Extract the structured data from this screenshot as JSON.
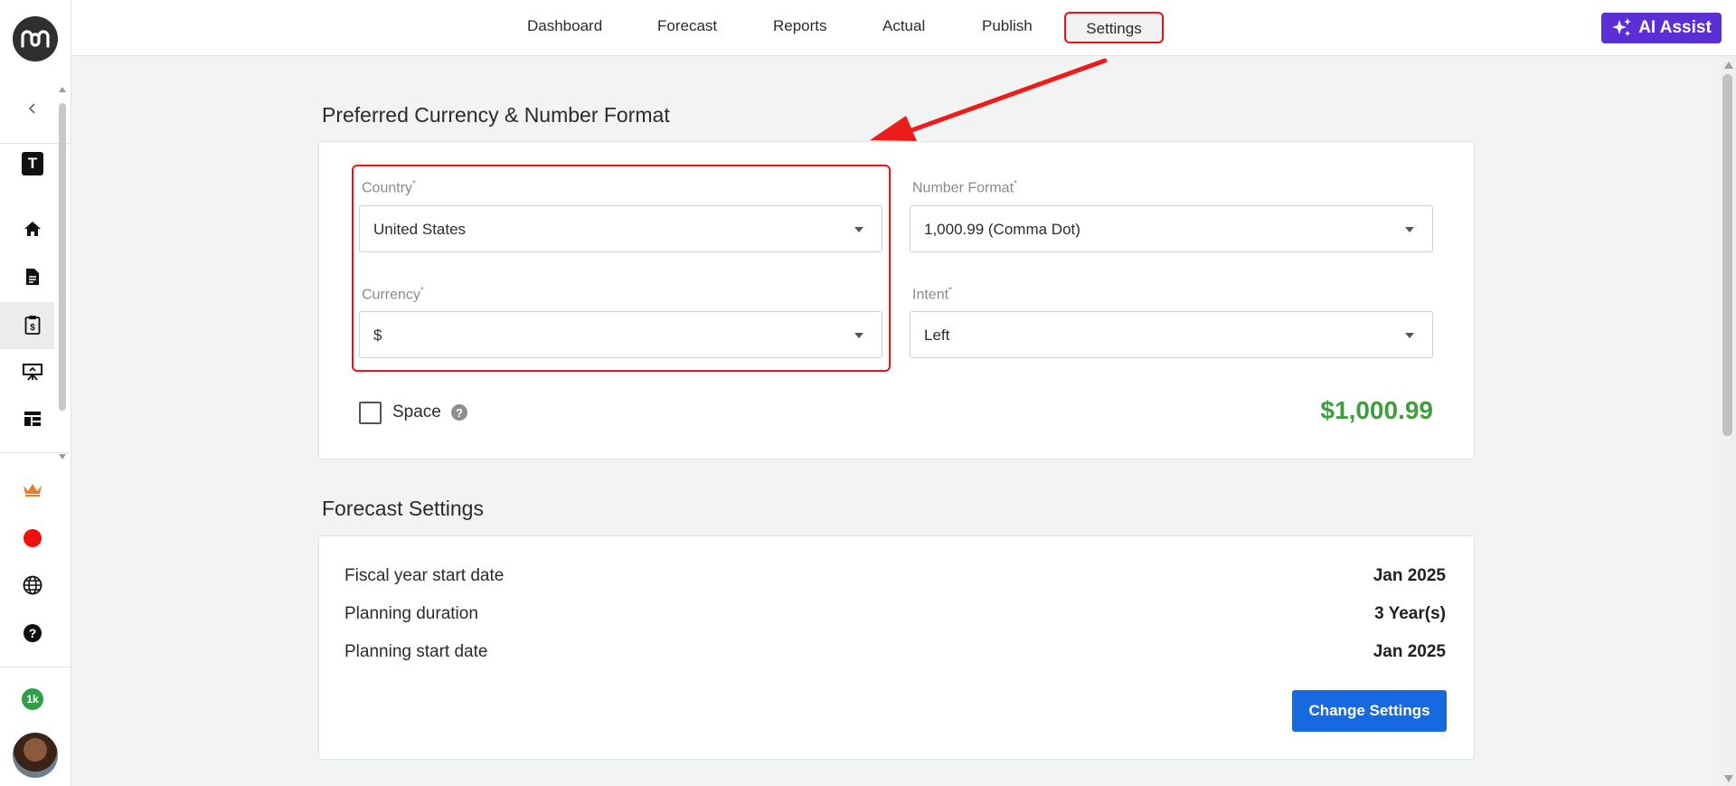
{
  "nav": {
    "items": [
      "Dashboard",
      "Forecast",
      "Reports",
      "Actual",
      "Publish"
    ],
    "active": "Settings"
  },
  "ai_assist": {
    "label": "AI Assist"
  },
  "sidebar": {
    "workspace_initial": "T",
    "credits_badge": "1k",
    "icons": [
      "home-icon",
      "document-icon",
      "budget-clipboard-icon",
      "presentation-icon",
      "dashboard-layout-icon",
      "crown-icon",
      "record-dot-icon",
      "globe-icon",
      "help-icon"
    ]
  },
  "currency_section": {
    "title": "Preferred Currency & Number Format",
    "country": {
      "label": "Country",
      "required_mark": "*",
      "value": "United States"
    },
    "currency": {
      "label": "Currency",
      "required_mark": "*",
      "value": "$"
    },
    "number_format": {
      "label": "Number Format",
      "required_mark": "*",
      "value": "1,000.99 (Comma Dot)"
    },
    "intent": {
      "label": "Intent",
      "required_mark": "*",
      "value": "Left"
    },
    "space": {
      "label": "Space",
      "checked": false,
      "help": "?"
    },
    "preview": "$1,000.99"
  },
  "forecast_section": {
    "title": "Forecast Settings",
    "rows": [
      {
        "label": "Fiscal year start date",
        "value": "Jan 2025"
      },
      {
        "label": "Planning duration",
        "value": "3 Year(s)"
      },
      {
        "label": "Planning start date",
        "value": "Jan 2025"
      }
    ],
    "button": "Change Settings"
  },
  "colors": {
    "accent": "#5b2ed6",
    "primary_button": "#1769e0",
    "preview_green": "#3f9d3f",
    "highlight_red": "#e11111"
  }
}
